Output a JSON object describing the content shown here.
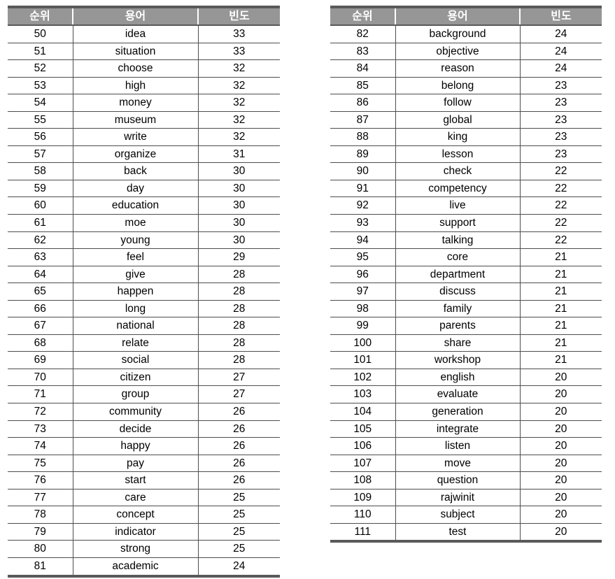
{
  "tables": [
    {
      "id": "left",
      "columns": [
        "순위",
        "용어",
        "빈도"
      ],
      "rows": [
        [
          "50",
          "idea",
          "33"
        ],
        [
          "51",
          "situation",
          "33"
        ],
        [
          "52",
          "choose",
          "32"
        ],
        [
          "53",
          "high",
          "32"
        ],
        [
          "54",
          "money",
          "32"
        ],
        [
          "55",
          "museum",
          "32"
        ],
        [
          "56",
          "write",
          "32"
        ],
        [
          "57",
          "organize",
          "31"
        ],
        [
          "58",
          "back",
          "30"
        ],
        [
          "59",
          "day",
          "30"
        ],
        [
          "60",
          "education",
          "30"
        ],
        [
          "61",
          "moe",
          "30"
        ],
        [
          "62",
          "young",
          "30"
        ],
        [
          "63",
          "feel",
          "29"
        ],
        [
          "64",
          "give",
          "28"
        ],
        [
          "65",
          "happen",
          "28"
        ],
        [
          "66",
          "long",
          "28"
        ],
        [
          "67",
          "national",
          "28"
        ],
        [
          "68",
          "relate",
          "28"
        ],
        [
          "69",
          "social",
          "28"
        ],
        [
          "70",
          "citizen",
          "27"
        ],
        [
          "71",
          "group",
          "27"
        ],
        [
          "72",
          "community",
          "26"
        ],
        [
          "73",
          "decide",
          "26"
        ],
        [
          "74",
          "happy",
          "26"
        ],
        [
          "75",
          "pay",
          "26"
        ],
        [
          "76",
          "start",
          "26"
        ],
        [
          "77",
          "care",
          "25"
        ],
        [
          "78",
          "concept",
          "25"
        ],
        [
          "79",
          "indicator",
          "25"
        ],
        [
          "80",
          "strong",
          "25"
        ],
        [
          "81",
          "academic",
          "24"
        ]
      ]
    },
    {
      "id": "right",
      "columns": [
        "순위",
        "용어",
        "빈도"
      ],
      "rows": [
        [
          "82",
          "background",
          "24"
        ],
        [
          "83",
          "objective",
          "24"
        ],
        [
          "84",
          "reason",
          "24"
        ],
        [
          "85",
          "belong",
          "23"
        ],
        [
          "86",
          "follow",
          "23"
        ],
        [
          "87",
          "global",
          "23"
        ],
        [
          "88",
          "king",
          "23"
        ],
        [
          "89",
          "lesson",
          "23"
        ],
        [
          "90",
          "check",
          "22"
        ],
        [
          "91",
          "competency",
          "22"
        ],
        [
          "92",
          "live",
          "22"
        ],
        [
          "93",
          "support",
          "22"
        ],
        [
          "94",
          "talking",
          "22"
        ],
        [
          "95",
          "core",
          "21"
        ],
        [
          "96",
          "department",
          "21"
        ],
        [
          "97",
          "discuss",
          "21"
        ],
        [
          "98",
          "family",
          "21"
        ],
        [
          "99",
          "parents",
          "21"
        ],
        [
          "100",
          "share",
          "21"
        ],
        [
          "101",
          "workshop",
          "21"
        ],
        [
          "102",
          "english",
          "20"
        ],
        [
          "103",
          "evaluate",
          "20"
        ],
        [
          "104",
          "generation",
          "20"
        ],
        [
          "105",
          "integrate",
          "20"
        ],
        [
          "106",
          "listen",
          "20"
        ],
        [
          "107",
          "move",
          "20"
        ],
        [
          "108",
          "question",
          "20"
        ],
        [
          "109",
          "rajwinit",
          "20"
        ],
        [
          "110",
          "subject",
          "20"
        ],
        [
          "111",
          "test",
          "20"
        ]
      ]
    }
  ],
  "colors": {
    "header_background": "#969696",
    "header_text": "#ffffff",
    "rule": "#595959",
    "grid": "#4d4d4d",
    "body_text": "#000000"
  }
}
